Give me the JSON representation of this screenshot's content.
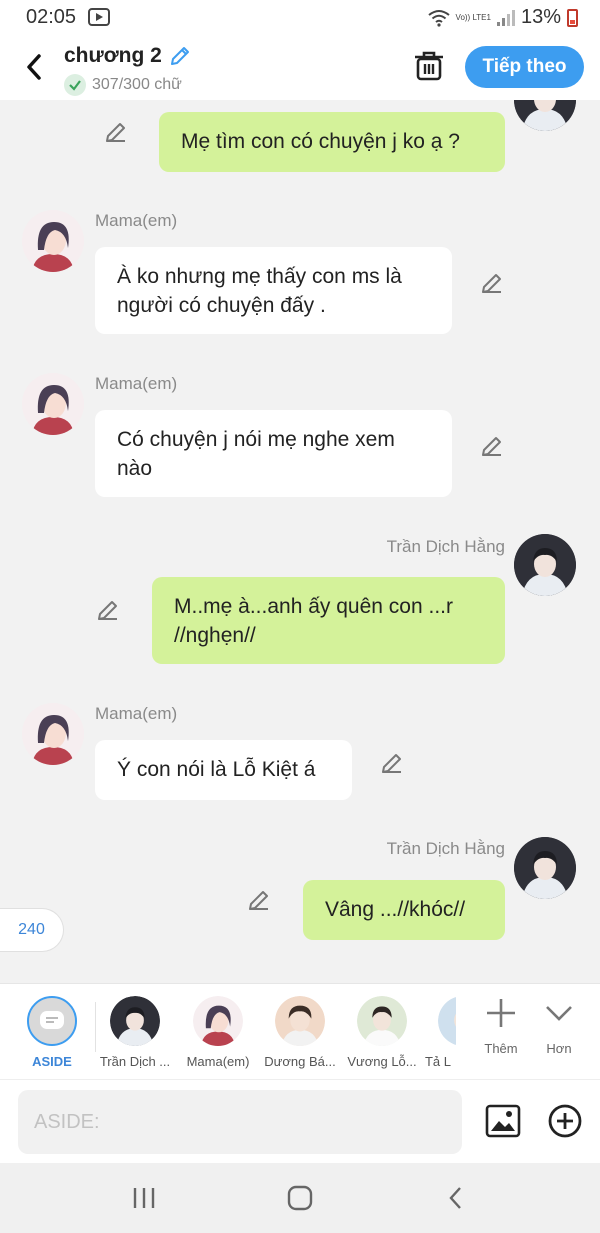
{
  "status": {
    "time": "02:05",
    "network_label": "Vo)) LTE1",
    "battery": "13%"
  },
  "header": {
    "title": "chương 2",
    "word_count": "307/300 chữ",
    "next_label": "Tiếp theo"
  },
  "messages": [
    {
      "side": "right",
      "name": "",
      "text": "Mẹ tìm con có chuyện j ko ạ ?"
    },
    {
      "side": "left",
      "name": "Mama(em)",
      "text": "À ko nhưng mẹ thấy con ms là người có chuyện đấy ."
    },
    {
      "side": "left",
      "name": "Mama(em)",
      "text": "Có chuyện j nói mẹ nghe xem nào"
    },
    {
      "side": "right",
      "name": "Trần Dịch Hằng",
      "text": "M..mẹ à...anh ấy quên con ...r //nghẹn//"
    },
    {
      "side": "left",
      "name": "Mama(em)",
      "text": "Ý con nói là Lỗ Kiệt á"
    },
    {
      "side": "right",
      "name": "Trần Dịch Hằng",
      "text": "Vâng ...//khóc//"
    }
  ],
  "counter": "240",
  "characters": [
    {
      "label": "ASIDE"
    },
    {
      "label": "Trần Dịch ..."
    },
    {
      "label": "Mama(em)"
    },
    {
      "label": "Dương Bá..."
    },
    {
      "label": "Vương Lỗ..."
    },
    {
      "label": "Tả L"
    }
  ],
  "tools": {
    "add_label": "Thêm",
    "more_label": "Hơn"
  },
  "input": {
    "placeholder": "ASIDE:"
  },
  "colors": {
    "accent": "#3d9df0",
    "bubble_right": "#d4f29a",
    "bubble_left": "#ffffff",
    "background": "#f2f2f2"
  }
}
